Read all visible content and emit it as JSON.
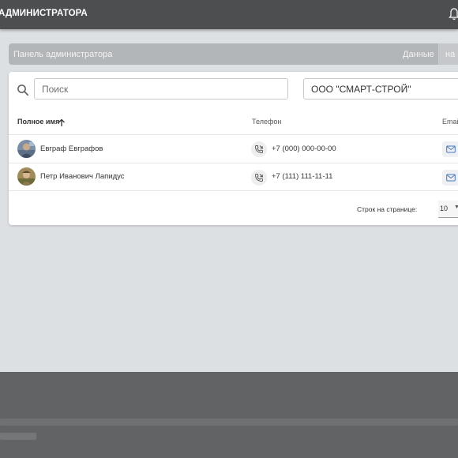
{
  "header": {
    "title": "АДМИНИСТРАТОРА",
    "bell_icon": "bell-icon"
  },
  "breadcrumb": {
    "left": "Панель администратора",
    "data": "Данные",
    "right": "на р"
  },
  "search": {
    "placeholder": "Поиск",
    "icon": "search-icon"
  },
  "company_select": {
    "value": "ООО \"СМАРТ-СТРОЙ\""
  },
  "table": {
    "columns": {
      "name": "Полное имя",
      "phone": "Телефон",
      "email": "Email"
    },
    "sort": "ascending",
    "rows": [
      {
        "name": "Евграф Евграфов",
        "phone": "+7 (000) 000-00-00"
      },
      {
        "name": "Петр Иванович Лапидус",
        "phone": "+7 (111) 111-11-11"
      }
    ]
  },
  "pagination": {
    "rows_per_page_label": "Строк на странице:",
    "rows_per_page": "10"
  },
  "colors": {
    "topbar": "#4d4e50",
    "background": "#dde0e3",
    "footer": "#616365"
  }
}
